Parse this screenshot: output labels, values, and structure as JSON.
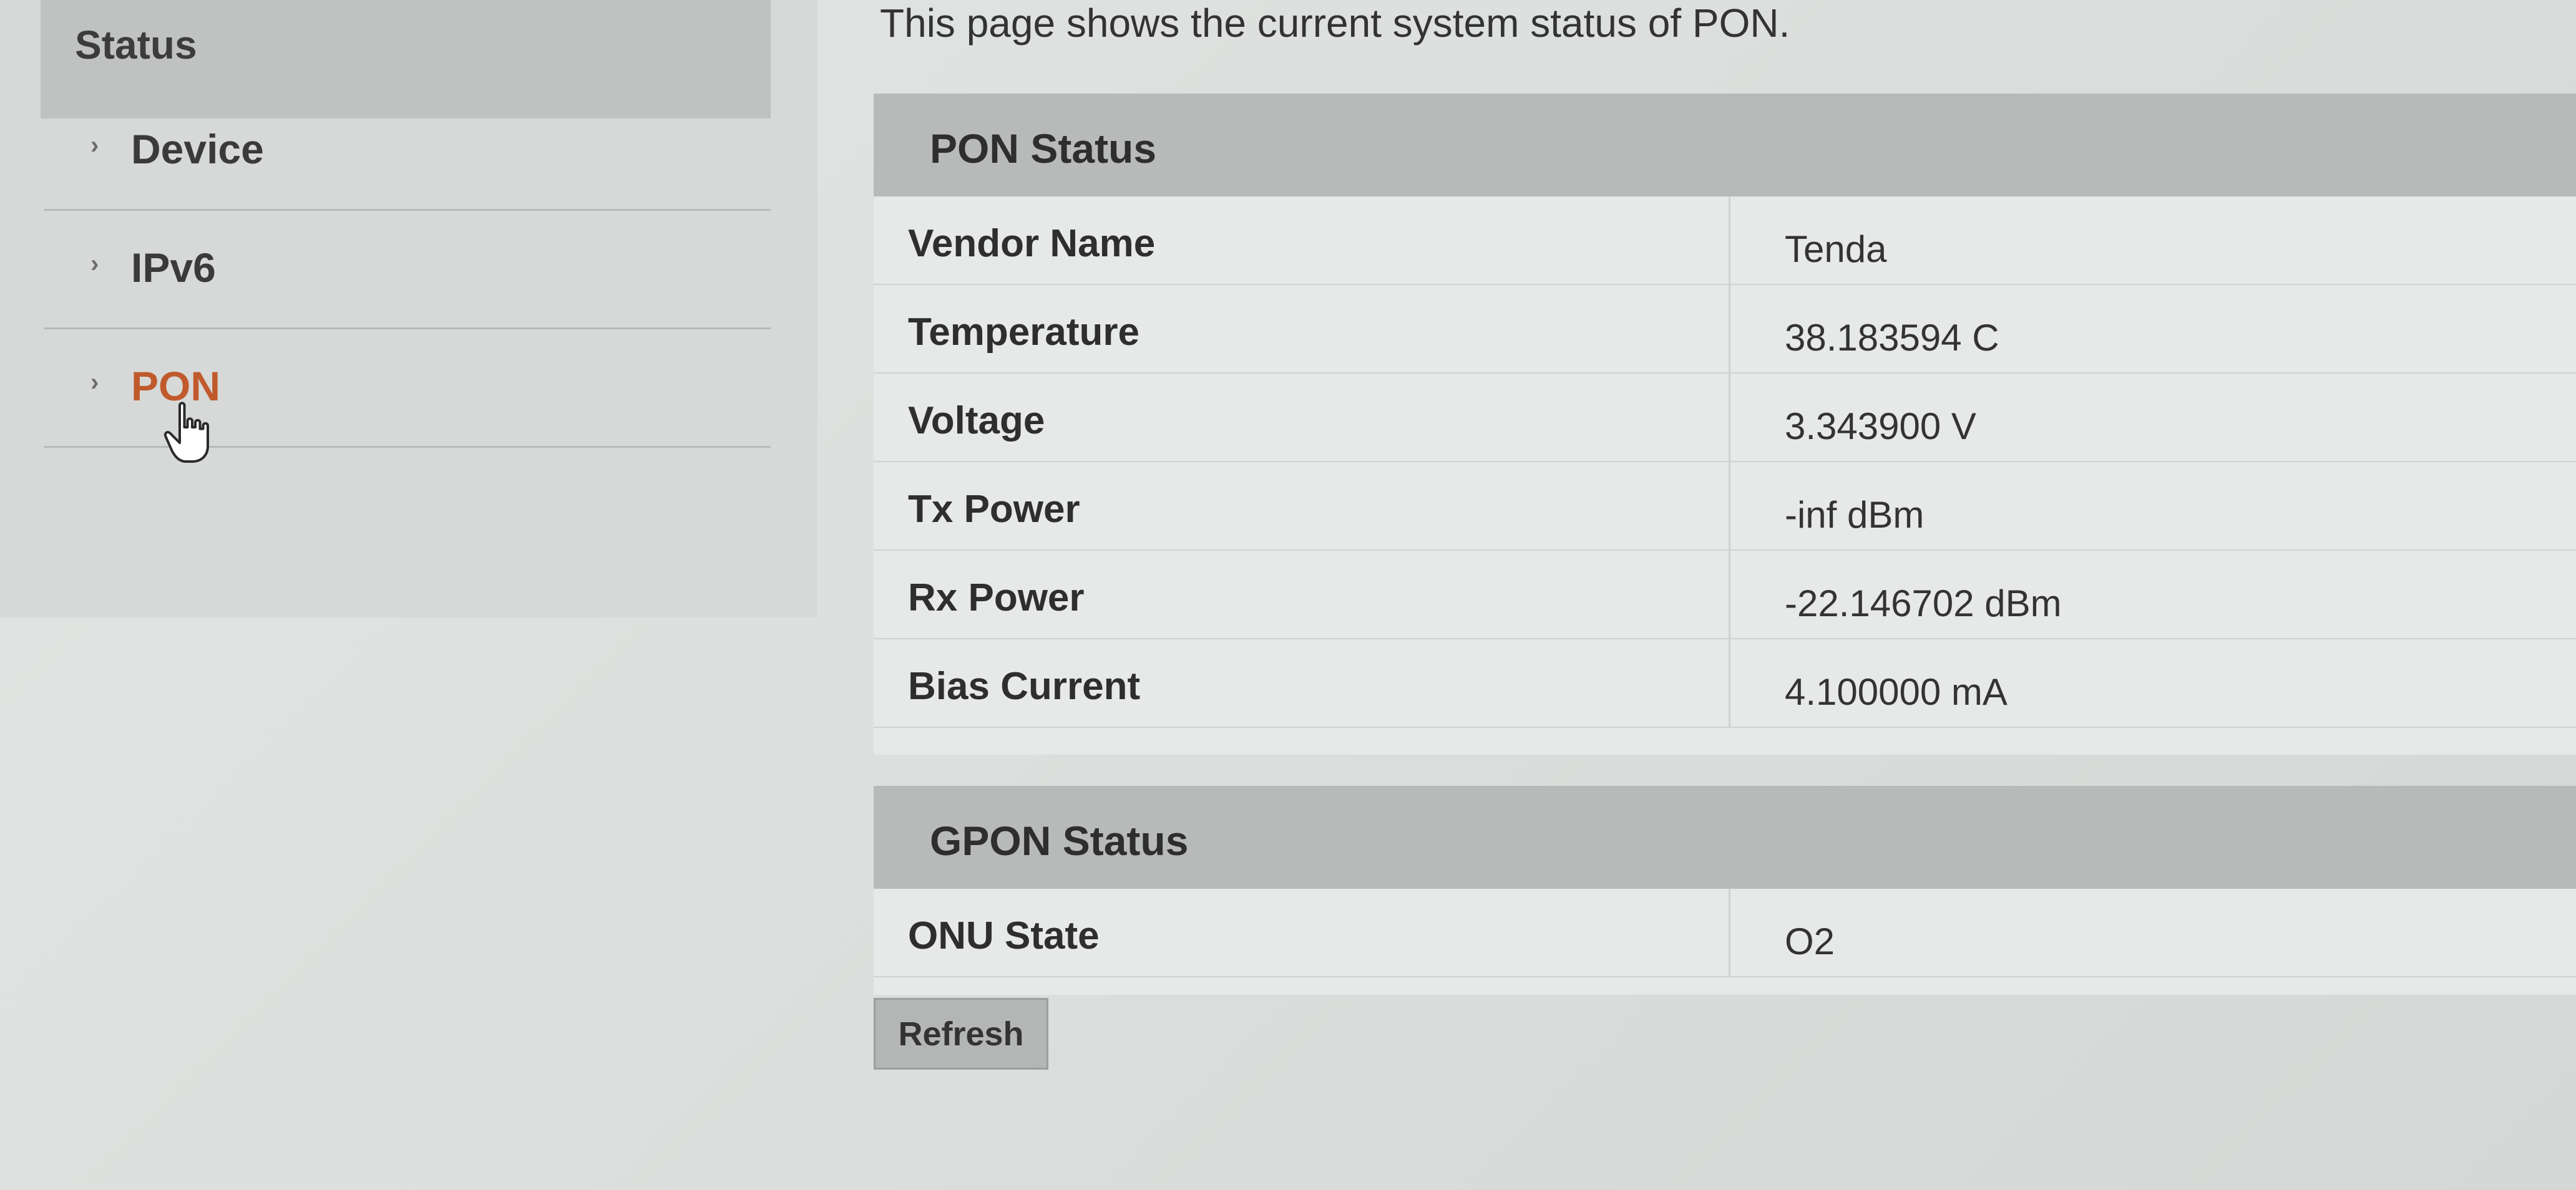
{
  "sidebar": {
    "header": "Status",
    "items": [
      {
        "label": "Device",
        "active": false
      },
      {
        "label": "IPv6",
        "active": false
      },
      {
        "label": "PON",
        "active": true
      }
    ]
  },
  "intro": "This page shows the current system status of PON.",
  "pon_status": {
    "title": "PON Status",
    "rows": [
      {
        "label": "Vendor Name",
        "value": "Tenda"
      },
      {
        "label": "Temperature",
        "value": "38.183594 C"
      },
      {
        "label": "Voltage",
        "value": "3.343900 V"
      },
      {
        "label": "Tx Power",
        "value": "-inf dBm"
      },
      {
        "label": "Rx Power",
        "value": "-22.146702 dBm"
      },
      {
        "label": "Bias Current",
        "value": "4.100000 mA"
      }
    ]
  },
  "gpon_status": {
    "title": "GPON Status",
    "rows": [
      {
        "label": "ONU State",
        "value": "O2"
      }
    ]
  },
  "refresh_label": "Refresh",
  "colors": {
    "active_link": "#c05a2c",
    "header_bg": "#b7bab8"
  },
  "icons": {
    "nav_marker": "chevron-right-icon",
    "pointer": "hand-cursor-icon"
  }
}
